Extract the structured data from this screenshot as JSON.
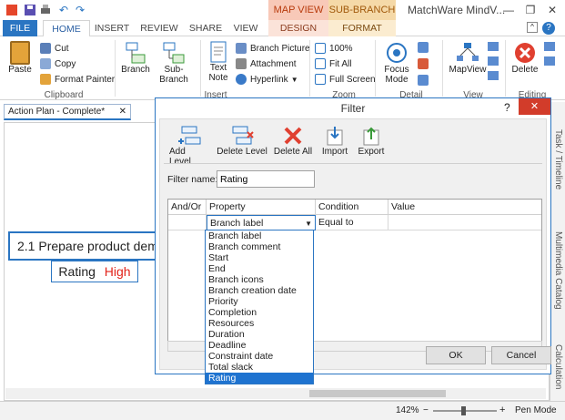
{
  "titlebar": {
    "app_title": "MatchWare MindV...",
    "context_tab_a": "MAP VIEW",
    "context_tab_b": "SUB-BRANCH",
    "minimize": "—",
    "restore": "❐",
    "close": "✕"
  },
  "tabs": [
    "FILE",
    "HOME",
    "INSERT",
    "REVIEW",
    "SHARE",
    "VIEW",
    "DESIGN",
    "FORMAT"
  ],
  "ribbon": {
    "clipboard": {
      "paste": "Paste",
      "cut": "Cut",
      "copy": "Copy",
      "format_painter": "Format Painter",
      "label": "Clipboard"
    },
    "branch": "Branch",
    "sub_branch": "Sub-Branch",
    "insert": {
      "text_note": "Text Note",
      "branch_picture": "Branch Picture",
      "attachment": "Attachment",
      "hyperlink": "Hyperlink",
      "label": "Insert"
    },
    "zoom": {
      "pct": "100%",
      "fit_all": "Fit All",
      "full_screen": "Full Screen",
      "label": "Zoom"
    },
    "detail": {
      "focus_mode": "Focus Mode",
      "label": "Detail"
    },
    "view": {
      "mapview": "MapView",
      "label": "View"
    },
    "editing": {
      "delete": "Delete",
      "label": "Editing"
    }
  },
  "document": {
    "tab": "Action Plan - Complete*",
    "branch_text": "2.1  Prepare product dem",
    "rating_label": "Rating",
    "rating_value": "High",
    "side_tab_1": "Task / Timeline",
    "side_tab_2": "Multimedia Catalog",
    "side_tab_3": "Calculation"
  },
  "status": {
    "zoom": "142%",
    "mode": "Pen Mode"
  },
  "dialog": {
    "title": "Filter",
    "help": "?",
    "close": "✕",
    "tools": [
      "Add Level",
      "Delete Level",
      "Delete All",
      "Import",
      "Export"
    ],
    "filter_name_label": "Filter name:",
    "filter_name_value": "Rating",
    "columns": [
      "And/Or",
      "Property",
      "Condition",
      "Value"
    ],
    "row": {
      "andor": "",
      "property": "Branch label",
      "condition": "Equal to",
      "value": ""
    },
    "dropdown_options": [
      "Branch label",
      "Branch comment",
      "Start",
      "End",
      "Branch icons",
      "Branch creation date",
      "Priority",
      "Completion",
      "Resources",
      "Duration",
      "Deadline",
      "Constraint date",
      "Total slack",
      "Rating"
    ],
    "selected_option": "Rating",
    "ok": "OK",
    "cancel": "Cancel"
  }
}
